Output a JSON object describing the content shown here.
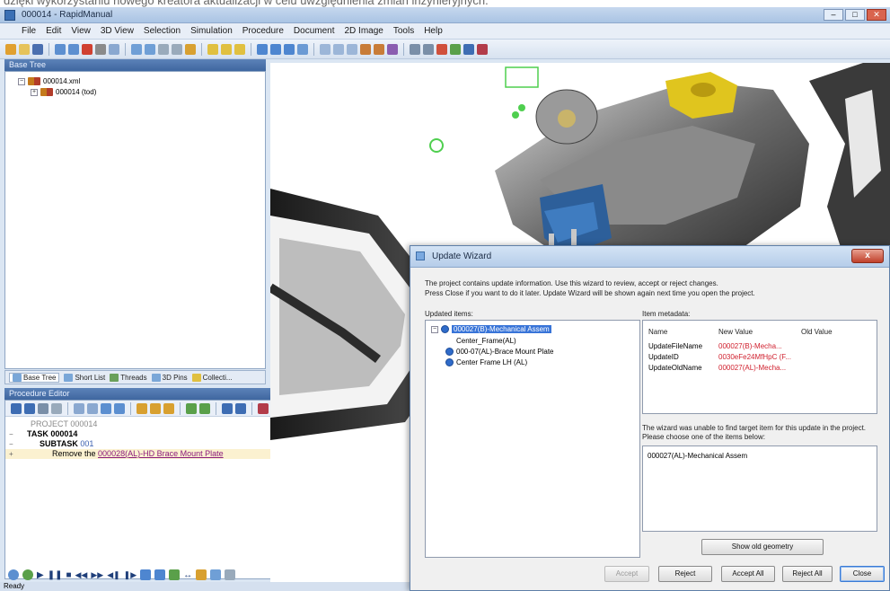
{
  "caption": "dzięki wykorzystaniu nowego kreatora aktualizacji w celu uwzględnienia zmian inżynieryjnych.",
  "window": {
    "title": "000014 - RapidManual"
  },
  "menu": [
    "File",
    "Edit",
    "View",
    "3D View",
    "Selection",
    "Simulation",
    "Procedure",
    "Document",
    "2D Image",
    "Tools",
    "Help"
  ],
  "tree": {
    "header": "Base Tree",
    "root": "000014.xml",
    "child": "000014 (tod)"
  },
  "tree_tabs": [
    "Base Tree",
    "Short List",
    "Threads",
    "3D Pins",
    "Collecti..."
  ],
  "procedure": {
    "header": "Procedure Editor",
    "project": "PROJECT 000014",
    "task": "TASK 000014",
    "subtask_label": "SUBTASK",
    "subtask_num": "001",
    "step_prefix": "Remove the",
    "step_link": "000028(AL)-HD Brace Mount Plate"
  },
  "status": "Ready",
  "dialog": {
    "title": "Update Wizard",
    "close_glyph": "x",
    "desc_line1": "The project contains update information. Use this wizard to review, accept or reject changes.",
    "desc_line2": "Press Close if you want to do it later. Update Wizard will be shown again next time you open the project.",
    "updated_items_label": "Updated items:",
    "items": [
      "000027(B)-Mechanical Assem",
      "Center_Frame(AL)",
      "000-07(AL)-Brace Mount Plate",
      "Center Frame LH (AL)"
    ],
    "metadata_label": "Item metadata:",
    "meta_headers": {
      "name": "Name",
      "new": "New Value",
      "old": "Old Value"
    },
    "meta_rows": [
      {
        "name": "UpdateFileName",
        "new": "000027(B)-Mecha..."
      },
      {
        "name": "UpdateID",
        "new": "0030eFe24MfHpC (F..."
      },
      {
        "name": "UpdateOldName",
        "new": "000027(AL)-Mecha..."
      }
    ],
    "warning": "The wizard was unable to find target item for this update in the project. Please choose one of the items below:",
    "choice": "000027(AL)-Mechanical Assem",
    "buttons": {
      "show_all": "Show old geometry",
      "accept": "Accept",
      "reject": "Reject",
      "accept_all": "Accept All",
      "reject_all": "Reject All",
      "close": "Close"
    }
  }
}
